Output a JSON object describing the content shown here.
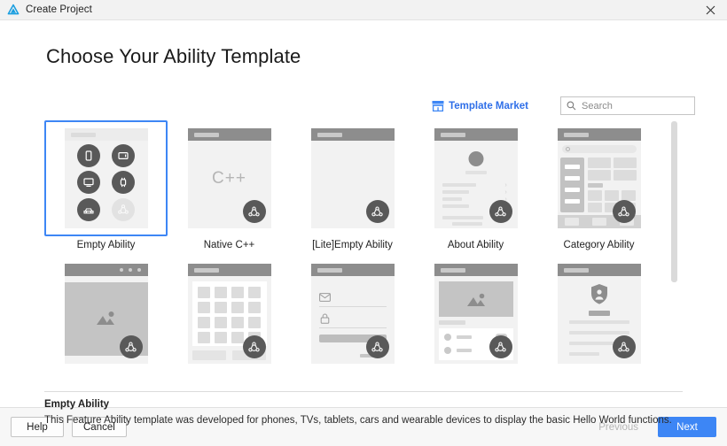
{
  "window": {
    "title": "Create Project",
    "logo_icon": "deveco-triangle-logo",
    "close_icon": "close-icon"
  },
  "page": {
    "heading": "Choose Your Ability Template"
  },
  "toolbar": {
    "template_market_label": "Template Market",
    "template_market_icon": "shop-icon",
    "template_market_color": "#2f6fe8",
    "search_icon": "search-icon",
    "search_value": "",
    "search_placeholder": "Search"
  },
  "templates": {
    "selected_index": 0,
    "accent_color": "#3d86f5",
    "items": [
      {
        "label": "Empty Ability",
        "thumb": "devices",
        "selected": true
      },
      {
        "label": "Native C++",
        "thumb": "cpp",
        "glyph": "C++",
        "selected": false
      },
      {
        "label": "[Lite]Empty Ability",
        "thumb": "blank",
        "selected": false
      },
      {
        "label": "About Ability",
        "thumb": "about",
        "selected": false
      },
      {
        "label": "Category Ability",
        "thumb": "category",
        "selected": false
      },
      {
        "label": "",
        "thumb": "gallery",
        "selected": false
      },
      {
        "label": "",
        "thumb": "grid",
        "selected": false
      },
      {
        "label": "",
        "thumb": "login",
        "selected": false
      },
      {
        "label": "",
        "thumb": "media",
        "selected": false
      },
      {
        "label": "",
        "thumb": "shield",
        "selected": false
      }
    ],
    "device_icons": [
      "phone-icon",
      "tablet-icon",
      "tv-icon",
      "watch-icon",
      "car-icon"
    ],
    "distribution_badge_icon": "distributed-nodes-icon"
  },
  "description": {
    "title": "Empty Ability",
    "body": "This Feature Ability template was developed for phones, TVs, tablets, cars and wearable devices to display the basic Hello World functions."
  },
  "footer": {
    "help_label": "Help",
    "cancel_label": "Cancel",
    "previous_label": "Previous",
    "next_label": "Next",
    "next_color": "#3d86f5"
  }
}
